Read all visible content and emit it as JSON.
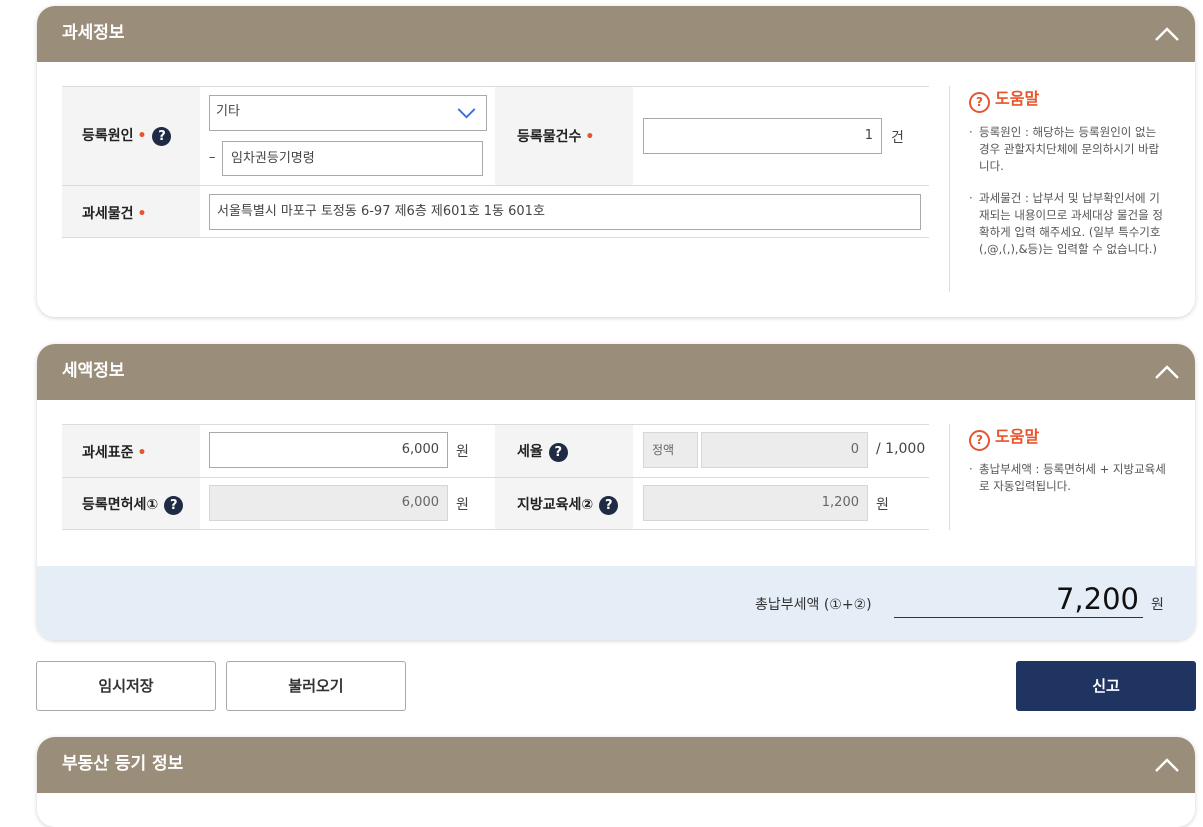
{
  "tax_info": {
    "title": "과세정보",
    "reg_cause_label": "등록원인",
    "reg_cause_selected": "기타",
    "reg_cause_dash": "–",
    "reg_cause_detail": "임차권등기명령",
    "reg_count_label": "등록물건수",
    "reg_count_value": "1",
    "reg_count_unit": "건",
    "tax_object_label": "과세물건",
    "tax_object_value": "서울특별시 마포구 토정동 6-97 제6층 제601호 1동 601호",
    "help_title": "도움말",
    "help_items": [
      "등록원인 : 해당하는 등록원인이 없는 경우 관할자치단체에 문의하시기 바랍니다.",
      "과세물건 : 납부서 및 납부확인서에 기재되는 내용이므로 과세대상 물건을 정확하게 입력 해주세요. (일부 특수기호 (,@,(,),&등)는 입력할 수 없습니다.)"
    ]
  },
  "tax_amount": {
    "title": "세액정보",
    "tax_base_label": "과세표준",
    "tax_base_value": "6,000",
    "tax_base_unit": "원",
    "tax_rate_label": "세율",
    "tax_rate_type": "정액",
    "tax_rate_value": "0",
    "tax_rate_suffix": "/ 1,000",
    "reg_license_tax_label": "등록면허세①",
    "reg_license_tax_value": "6,000",
    "reg_license_tax_unit": "원",
    "local_edu_tax_label": "지방교육세②",
    "local_edu_tax_value": "1,200",
    "local_edu_tax_unit": "원",
    "help_title": "도움말",
    "help_items": [
      "총납부세액 : 등록면허세 + 지방교육세로 자동입력됩니다."
    ],
    "total_label": "총납부세액 (①+②)",
    "total_value": "7,200",
    "total_unit": "원"
  },
  "actions": {
    "temp_save": "임시저장",
    "load": "불러오기",
    "submit": "신고"
  },
  "realestate": {
    "title": "부동산 등기 정보"
  },
  "colors": {
    "header_bg": "#9a8d7a",
    "required": "#e8542c",
    "primary": "#1f3461",
    "total_bg": "#e5eef7"
  }
}
